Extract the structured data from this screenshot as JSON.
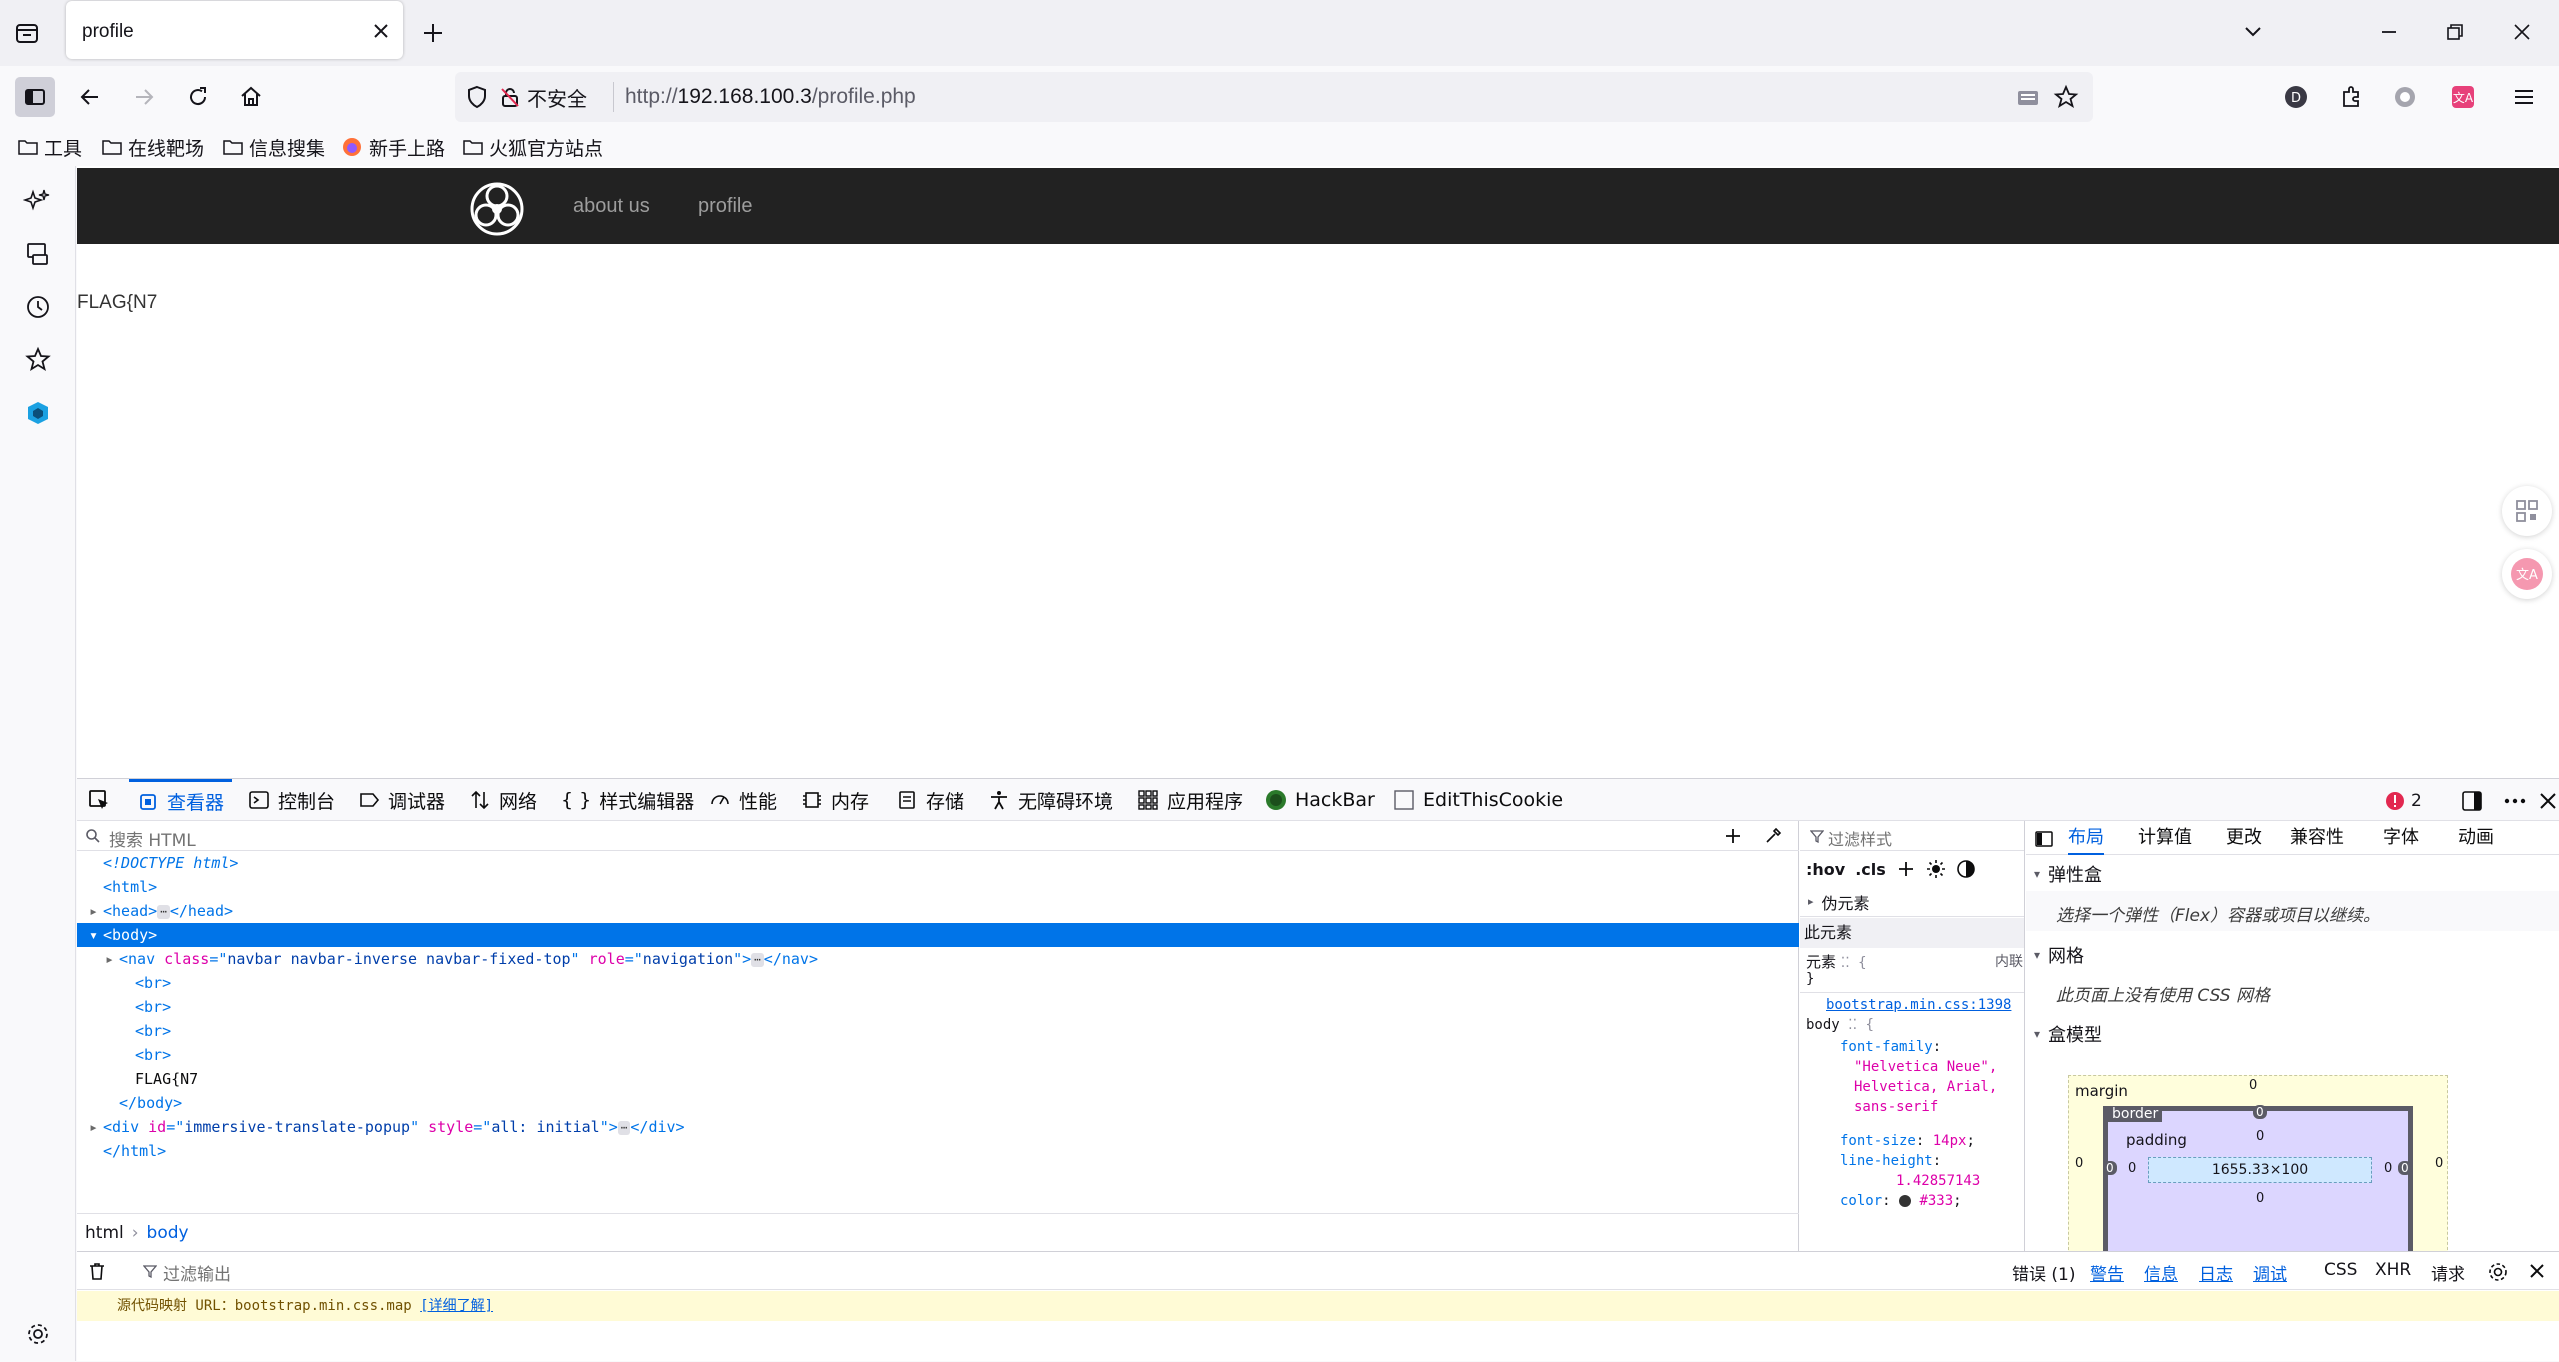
{
  "browser": {
    "tab_title": "profile",
    "url_prefix": "http://",
    "url_host": "192.168.100.3",
    "url_path": "/profile.php",
    "insecure_label": "不安全"
  },
  "bookmarks": [
    "工具",
    "在线靶场",
    "信息搜集",
    "新手上路",
    "火狐官方站点"
  ],
  "page": {
    "nav_links": [
      "about us",
      "profile"
    ],
    "flag_text": "FLAG{N7"
  },
  "devtools": {
    "tabs": [
      "查看器",
      "控制台",
      "调试器",
      "网络",
      "样式编辑器",
      "性能",
      "内存",
      "存储",
      "无障碍环境",
      "应用程序",
      "HackBar",
      "EditThisCookie"
    ],
    "error_count": "2",
    "search_placeholder": "搜索 HTML",
    "markup": {
      "doctype": "<!DOCTYPE html>",
      "nav_class": "navbar navbar-inverse navbar-fixed-top",
      "nav_role": "navigation",
      "text_node": "FLAG{N7",
      "div_id": "immersive-translate-popup",
      "div_style": "all: initial"
    },
    "breadcrumbs": [
      "html",
      "body"
    ],
    "rules": {
      "filter_placeholder": "过滤样式",
      "hov": ":hov",
      "cls": ".cls",
      "pseudo": "伪元素",
      "this_element": "此元素",
      "element_label": "元素",
      "inline_label": "内联",
      "source": "bootstrap.min.css:1398",
      "selector": "body",
      "decls": [
        {
          "prop": "font-family",
          "val": "\"Helvetica Neue\", Helvetica, Arial, sans-serif"
        },
        {
          "prop": "font-size",
          "val": "14px"
        },
        {
          "prop": "line-height",
          "val": "1.42857143"
        },
        {
          "prop": "color",
          "val": "#333"
        }
      ]
    },
    "layout": {
      "tabs": [
        "布局",
        "计算值",
        "更改",
        "兼容性",
        "字体",
        "动画"
      ],
      "flex_header": "弹性盒",
      "flex_text": "选择一个弹性（Flex）容器或项目以继续。",
      "grid_header": "网格",
      "grid_text": "此页面上没有使用 CSS 网格",
      "box_header": "盒模型",
      "margin_label": "margin",
      "border_label": "border",
      "padding_label": "padding",
      "content_size": "1655.33×100",
      "zero": "0"
    },
    "console": {
      "filter_placeholder": "过滤输出",
      "levels": [
        "错误 (1)",
        "警告",
        "信息",
        "日志",
        "调试"
      ],
      "extras": [
        "CSS",
        "XHR",
        "请求"
      ],
      "warn_text": "源代码映射 URL：bootstrap.min.css.map ",
      "warn_link": "[详细了解]"
    }
  },
  "colors": {
    "accent": "#0060df",
    "navbar_bg": "#222222",
    "selection": "#0074e8"
  }
}
